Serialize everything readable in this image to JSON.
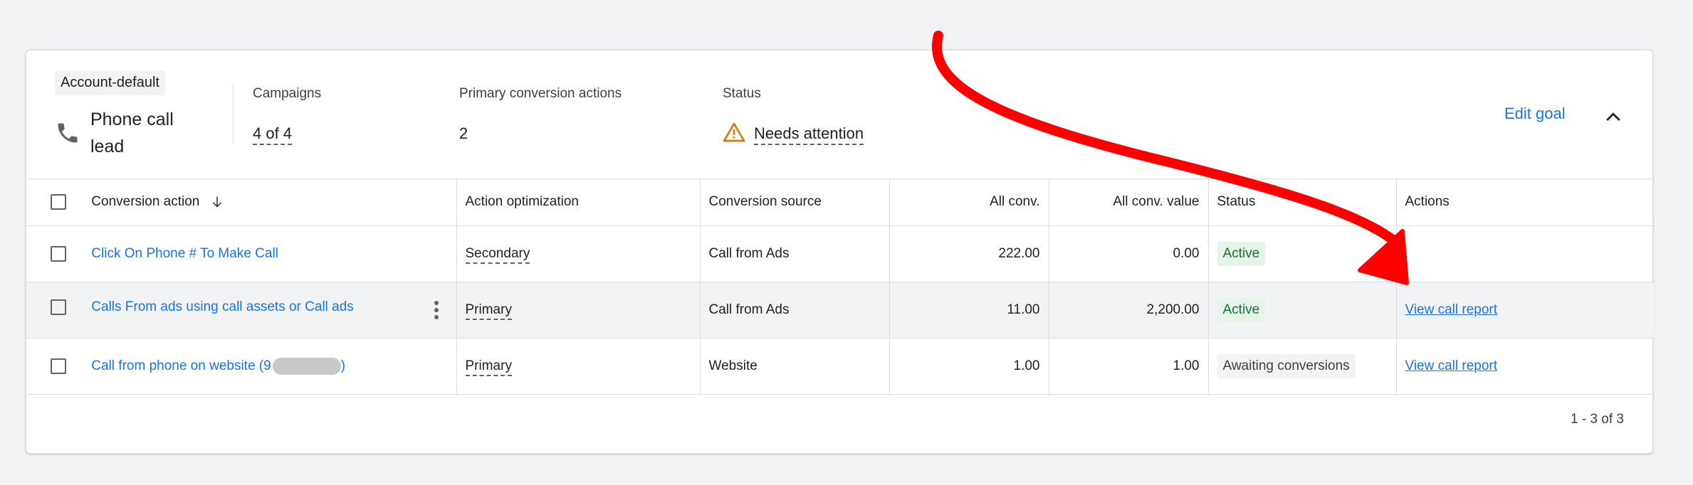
{
  "goal": {
    "chip": "Account-default",
    "icon": "phone-icon",
    "name": "Phone call lead",
    "campaigns_label": "Campaigns",
    "campaigns_value": "4 of 4",
    "primary_label": "Primary conversion actions",
    "primary_value": "2",
    "status_label": "Status",
    "status_value": "Needs attention",
    "status_icon": "warning-icon",
    "status_color": "#e37400",
    "edit_label": "Edit goal",
    "collapse_icon": "chevron-up-icon"
  },
  "table": {
    "headers": {
      "action": "Conversion action",
      "optimization": "Action optimization",
      "source": "Conversion source",
      "all_conv": "All conv.",
      "all_conv_value": "All conv. value",
      "status": "Status",
      "actions": "Actions"
    },
    "rows": [
      {
        "name": "Click On Phone # To Make Call",
        "optimization": "Secondary",
        "source": "Call from Ads",
        "all_conv": "222.00",
        "all_conv_value": "0.00",
        "status": "Active",
        "action": ""
      },
      {
        "name": "Calls From ads using call assets or Call ads",
        "optimization": "Primary",
        "source": "Call from Ads",
        "all_conv": "11.00",
        "all_conv_value": "2,200.00",
        "status": "Active",
        "action": "View call report"
      },
      {
        "name": "Call from phone on website (9",
        "name_suffix": ")",
        "optimization": "Primary",
        "source": "Website",
        "all_conv": "1.00",
        "all_conv_value": "1.00",
        "status": "Awaiting conversions",
        "action": "View call report"
      }
    ]
  },
  "pagination": "1 - 3 of 3",
  "colors": {
    "link": "#1a73e8",
    "active_bg": "#e6f4ea",
    "active_text": "#137333",
    "annotation_arrow": "#ff0000"
  }
}
